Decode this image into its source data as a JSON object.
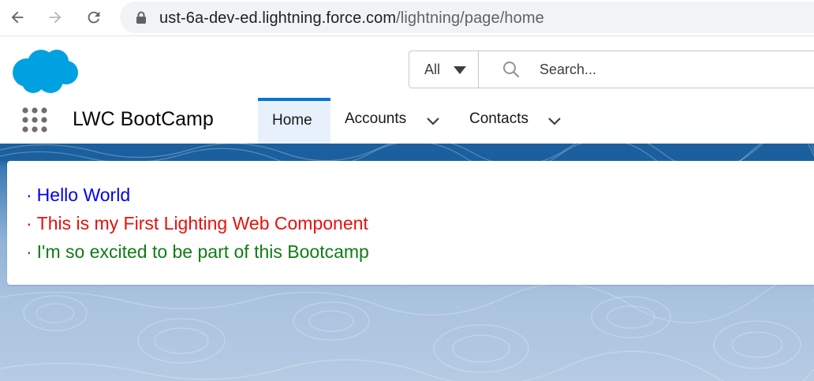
{
  "browser": {
    "url_host": "ust-6a-dev-ed.lightning.force.com",
    "url_path": "/lightning/page/home"
  },
  "header": {
    "search_scope": "All",
    "search_placeholder": "Search..."
  },
  "app": {
    "name": "LWC BootCamp",
    "tabs": [
      {
        "label": "Home",
        "active": true
      },
      {
        "label": "Accounts",
        "active": false
      },
      {
        "label": "Contacts",
        "active": false
      }
    ]
  },
  "card": {
    "bullet": "·",
    "messages": [
      {
        "text": "Hello World",
        "color": "#0000ee"
      },
      {
        "text": "This is my First Lighting Web Component",
        "color": "#e8100c"
      },
      {
        "text": "I'm so excited to be part of this Bootcamp",
        "color": "#0d7d14"
      }
    ]
  },
  "colors": {
    "brand_blue": "#0176d3",
    "salesforce_cloud": "#00a1e0",
    "header_band": "#1b5f9e"
  }
}
